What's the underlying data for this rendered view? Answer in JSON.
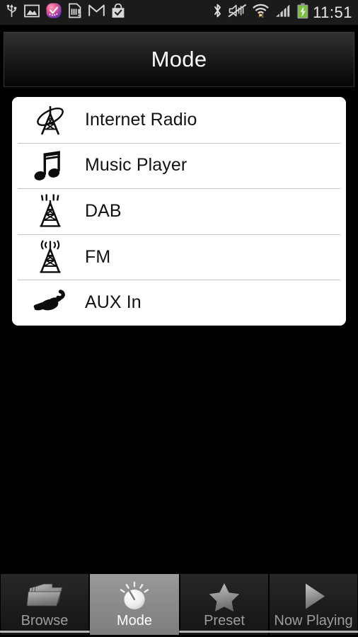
{
  "statusbar": {
    "clock": "11:51",
    "left_icons": [
      {
        "name": "usb-icon",
        "label": "USB connected"
      },
      {
        "name": "screenshot-image-icon",
        "label": "Screenshot captured"
      },
      {
        "name": "app-update-icon",
        "label": "App notification"
      },
      {
        "name": "sim-card-alert-icon",
        "label": "SIM card alert"
      },
      {
        "name": "gmail-icon",
        "label": "New Gmail"
      },
      {
        "name": "play-store-bag-icon",
        "label": "Play Store"
      }
    ],
    "right_icons": [
      {
        "name": "bluetooth-icon",
        "label": "Bluetooth on"
      },
      {
        "name": "sound-muted-vibrate-icon",
        "label": "Sound muted / vibrate"
      },
      {
        "name": "wifi-signal-icon",
        "label": "Wi-Fi connected, data transfer"
      },
      {
        "name": "cellular-signal-icon",
        "label": "Mobile signal"
      },
      {
        "name": "battery-charging-icon",
        "label": "Battery charging"
      }
    ]
  },
  "titlebar": {
    "title": "Mode"
  },
  "mode_list": {
    "items": [
      {
        "icon": "internet-radio-tower-icon",
        "label": "Internet Radio"
      },
      {
        "icon": "music-note-icon",
        "label": "Music Player"
      },
      {
        "icon": "dab-tower-icon",
        "label": "DAB"
      },
      {
        "icon": "fm-tower-icon",
        "label": "FM"
      },
      {
        "icon": "aux-plug-icon",
        "label": "AUX In"
      }
    ]
  },
  "tabbar": {
    "selected": "Mode",
    "tabs": [
      {
        "id": "browse",
        "label": "Browse",
        "icon": "folders-icon",
        "selected": false
      },
      {
        "id": "mode",
        "label": "Mode",
        "icon": "knob-dial-icon",
        "selected": true
      },
      {
        "id": "preset",
        "label": "Preset",
        "icon": "star-icon",
        "selected": false
      },
      {
        "id": "now-playing",
        "label": "Now Playing",
        "icon": "play-triangle-icon",
        "selected": false
      }
    ]
  },
  "colors": {
    "background": "#000000",
    "card": "#ffffff",
    "separator": "#c6c6c6",
    "title_text": "#ffffff",
    "tab_text_inactive": "#9d9d9d",
    "tab_text_active": "#ffffff",
    "tab_selected_bg": "#8d8d8d",
    "status_bar_bg": "#1b1b1b",
    "battery_green": "#7bc043",
    "wifi_arrow_orange": "#e08a1e"
  }
}
